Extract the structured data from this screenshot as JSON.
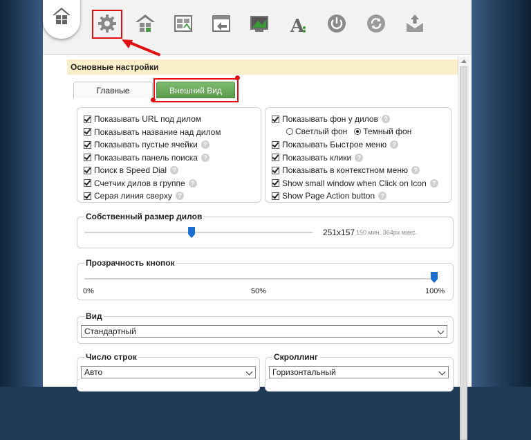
{
  "toolbar": {
    "icons": [
      "home-icon",
      "settings-gear-icon",
      "dials-icon",
      "layout-icon",
      "backup-icon",
      "image-icon",
      "font-icon",
      "power-icon",
      "refresh-icon",
      "mail-upload-icon"
    ],
    "selected": "settings-gear-icon"
  },
  "panel": {
    "title": "Основные настройки"
  },
  "tabs": {
    "main": "Главные",
    "view": "Внешний Вид"
  },
  "left_options": [
    {
      "label": "Показывать URL под дилом",
      "checked": true,
      "help": false
    },
    {
      "label": "Показывать название над дилом",
      "checked": true,
      "help": false
    },
    {
      "label": "Показывать пустые ячейки",
      "checked": true,
      "help": true
    },
    {
      "label": "Показывать панель поиска",
      "checked": true,
      "help": true
    },
    {
      "label": "Поиск в Speed Dial",
      "checked": true,
      "help": true
    },
    {
      "label": "Счетчик дилов в группе",
      "checked": true,
      "help": true
    },
    {
      "label": "Серая линия сверху",
      "checked": true,
      "help": true
    }
  ],
  "right_options": {
    "show_bg": {
      "label": "Показывать фон у дилов",
      "checked": true
    },
    "radio_light": "Светлый фон",
    "radio_dark": "Темный фон",
    "radio_selected": "dark",
    "items": [
      {
        "label": "Показывать Быстрое меню",
        "checked": true,
        "help": true
      },
      {
        "label": "Показывать клики",
        "checked": true,
        "help": true
      },
      {
        "label": "Показывать в контекстном меню",
        "checked": true,
        "help": true
      },
      {
        "label": "Show small window when Click on Icon",
        "checked": true,
        "help": true
      },
      {
        "label": "Show Page Action button",
        "checked": true,
        "help": true
      }
    ]
  },
  "dial_size": {
    "legend": "Собственный размер дилов",
    "value": "251x157",
    "hint": "150 мин, 364px макс.",
    "level": 0.47
  },
  "button_opacity": {
    "legend": "Прозрачность кнопок",
    "min_label": "0%",
    "mid_label": "50%",
    "max_label": "100%",
    "level": 1.0
  },
  "view": {
    "legend": "Вид",
    "selected": "Стандартный"
  },
  "rows": {
    "legend": "Число строк",
    "selected": "Авто"
  },
  "scrolling": {
    "legend": "Скроллинг",
    "selected": "Горизонтальный"
  },
  "colors": {
    "accent_green": "#5a9a4b",
    "highlight_red": "#e01010",
    "slider_blue": "#1a6fd0",
    "header_yellow": "#fbefc9"
  }
}
